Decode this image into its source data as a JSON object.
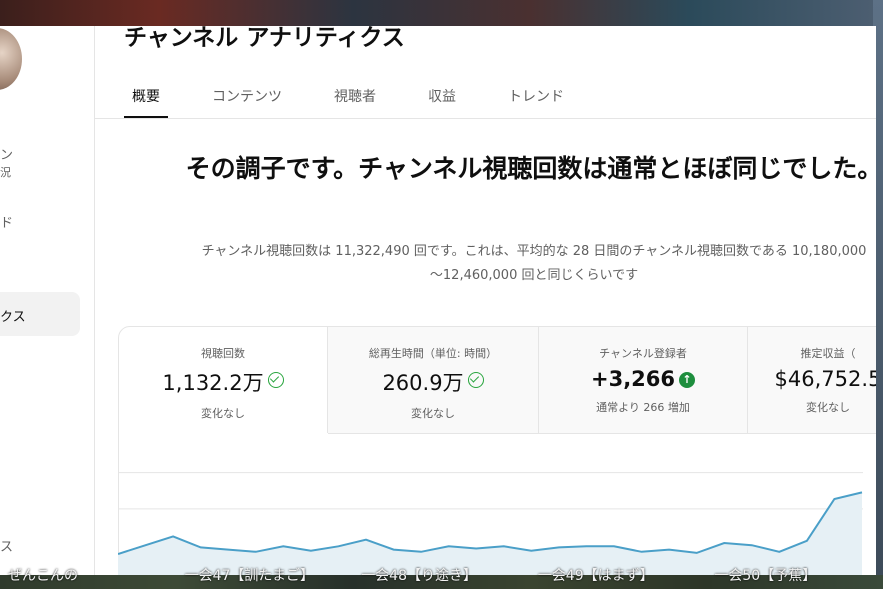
{
  "background_strip": [
    "ぜんこんの",
    "一会47【訓たまご】",
    "一会48【り途き】",
    "一会49【はまず】",
    "一会50【予蕉】"
  ],
  "sidebar": {
    "partial_name_1": "ン",
    "partial_name_2": "況",
    "item_1": "ド",
    "item_active": "クス",
    "item_4": "ス"
  },
  "page": {
    "title": "チャンネル アナリティクス",
    "tabs": [
      "概要",
      "コンテンツ",
      "視聴者",
      "収益",
      "トレンド"
    ],
    "active_tab": "概要",
    "headline": "その調子です。チャンネル視聴回数は通常とほぼ同じでした。",
    "subline_1": "チャンネル視聴回数は 11,322,490 回です。これは、平均的な 28 日間のチャンネル視聴回数である 10,180,000",
    "subline_2": "～12,460,000 回と同じくらいです"
  },
  "cards": [
    {
      "label": "視聴回数",
      "value": "1,132.2万",
      "sub": "変化なし",
      "icon": "check-circle-icon"
    },
    {
      "label": "総再生時間（単位: 時間）",
      "value": "260.9万",
      "sub": "変化なし",
      "icon": "check-circle-icon"
    },
    {
      "label": "チャンネル登録者",
      "value": "+3,266",
      "sub": "通常より 266 増加",
      "icon": "arrow-up-circle-icon"
    },
    {
      "label": "推定収益（",
      "value": "$46,752.5",
      "sub": "変化なし",
      "icon": ""
    }
  ],
  "colors": {
    "accent": "#0f0f0f",
    "positive": "#2ba640",
    "up_badge": "#1e8e3e",
    "line": "#4a9fc8"
  },
  "chart_data": {
    "type": "area",
    "title": "",
    "xlabel": "",
    "ylabel": "",
    "values": [
      20,
      28,
      36,
      26,
      24,
      22,
      27,
      23,
      27,
      33,
      24,
      22,
      27,
      25,
      27,
      23,
      26,
      27,
      27,
      22,
      24,
      21,
      30,
      28,
      22,
      32,
      70,
      76
    ],
    "ylim": [
      0,
      100
    ],
    "grid": true
  }
}
